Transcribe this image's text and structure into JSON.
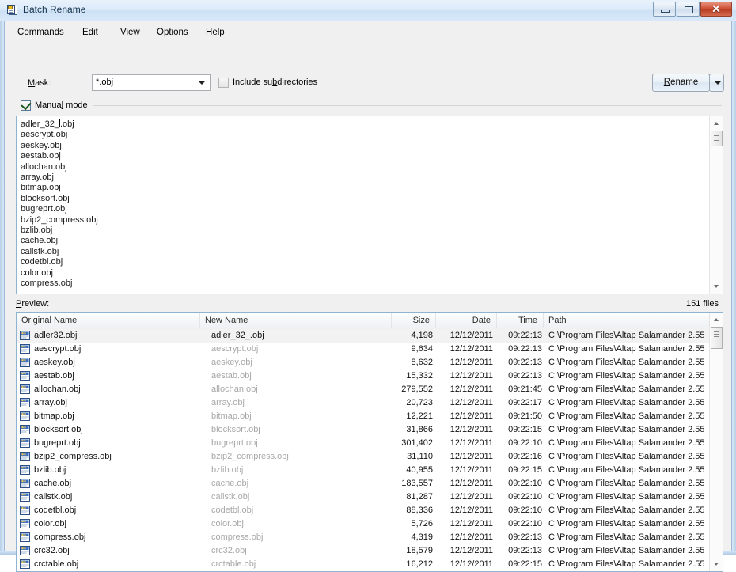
{
  "window": {
    "title": "Batch Rename",
    "icon": "batch-rename-icon",
    "minimize_label": "–",
    "maximize_label": "□",
    "close_label": "✕"
  },
  "menu": [
    {
      "label": "Commands",
      "accel": "C"
    },
    {
      "label": "Edit",
      "accel": "E"
    },
    {
      "label": "View",
      "accel": "V"
    },
    {
      "label": "Options",
      "accel": "O"
    },
    {
      "label": "Help",
      "accel": "H"
    }
  ],
  "options": {
    "mask_label": "Mask:",
    "mask_value": "*.obj",
    "mask_placeholder": "*.*",
    "include_subdirs_label": "Include subdirectories",
    "include_subdirs_checked": false,
    "manual_mode_label": "Manual mode",
    "manual_mode_checked": true,
    "rename_button": "Rename",
    "rename_dropdown_icon": "chevron-down-icon"
  },
  "editor": {
    "lines": [
      "adler_32_.obj",
      "aescrypt.obj",
      "aeskey.obj",
      "aestab.obj",
      "allochan.obj",
      "array.obj",
      "bitmap.obj",
      "blocksort.obj",
      "bugreprt.obj",
      "bzip2_compress.obj",
      "bzlib.obj",
      "cache.obj",
      "callstk.obj",
      "codetbl.obj",
      "color.obj",
      "compress.obj"
    ],
    "caret_line": 0,
    "caret_col": 9
  },
  "preview": {
    "label": "Preview:",
    "files_count": "151 files",
    "columns": [
      {
        "key": "original",
        "label": "Original Name",
        "align": "left"
      },
      {
        "key": "newname",
        "label": "New Name",
        "align": "left"
      },
      {
        "key": "size",
        "label": "Size",
        "align": "right"
      },
      {
        "key": "date",
        "label": "Date",
        "align": "right"
      },
      {
        "key": "time",
        "label": "Time",
        "align": "right"
      },
      {
        "key": "path",
        "label": "Path",
        "align": "left"
      }
    ],
    "rows": [
      {
        "icon": "file-obj-icon",
        "original": "adler32.obj",
        "newname": "adler_32_.obj",
        "size": "4,198",
        "date": "12/12/2011",
        "time": "09:22:13",
        "path": "C:\\Program Files\\Altap Salamander 2.55",
        "selected": true
      },
      {
        "icon": "file-obj-icon",
        "original": "aescrypt.obj",
        "newname": "aescrypt.obj",
        "size": "9,634",
        "date": "12/12/2011",
        "time": "09:22:13",
        "path": "C:\\Program Files\\Altap Salamander 2.55",
        "selected": false
      },
      {
        "icon": "file-obj-icon",
        "original": "aeskey.obj",
        "newname": "aeskey.obj",
        "size": "8,632",
        "date": "12/12/2011",
        "time": "09:22:13",
        "path": "C:\\Program Files\\Altap Salamander 2.55",
        "selected": false
      },
      {
        "icon": "file-obj-icon",
        "original": "aestab.obj",
        "newname": "aestab.obj",
        "size": "15,332",
        "date": "12/12/2011",
        "time": "09:22:13",
        "path": "C:\\Program Files\\Altap Salamander 2.55",
        "selected": false
      },
      {
        "icon": "file-obj-icon",
        "original": "allochan.obj",
        "newname": "allochan.obj",
        "size": "279,552",
        "date": "12/12/2011",
        "time": "09:21:45",
        "path": "C:\\Program Files\\Altap Salamander 2.55",
        "selected": false
      },
      {
        "icon": "file-obj-icon",
        "original": "array.obj",
        "newname": "array.obj",
        "size": "20,723",
        "date": "12/12/2011",
        "time": "09:22:17",
        "path": "C:\\Program Files\\Altap Salamander 2.55",
        "selected": false
      },
      {
        "icon": "file-obj-icon",
        "original": "bitmap.obj",
        "newname": "bitmap.obj",
        "size": "12,221",
        "date": "12/12/2011",
        "time": "09:21:50",
        "path": "C:\\Program Files\\Altap Salamander 2.55",
        "selected": false
      },
      {
        "icon": "file-obj-icon",
        "original": "blocksort.obj",
        "newname": "blocksort.obj",
        "size": "31,866",
        "date": "12/12/2011",
        "time": "09:22:15",
        "path": "C:\\Program Files\\Altap Salamander 2.55",
        "selected": false
      },
      {
        "icon": "file-obj-icon",
        "original": "bugreprt.obj",
        "newname": "bugreprt.obj",
        "size": "301,402",
        "date": "12/12/2011",
        "time": "09:22:10",
        "path": "C:\\Program Files\\Altap Salamander 2.55",
        "selected": false
      },
      {
        "icon": "file-obj-icon",
        "original": "bzip2_compress.obj",
        "newname": "bzip2_compress.obj",
        "size": "31,110",
        "date": "12/12/2011",
        "time": "09:22:16",
        "path": "C:\\Program Files\\Altap Salamander 2.55",
        "selected": false
      },
      {
        "icon": "file-obj-icon",
        "original": "bzlib.obj",
        "newname": "bzlib.obj",
        "size": "40,955",
        "date": "12/12/2011",
        "time": "09:22:15",
        "path": "C:\\Program Files\\Altap Salamander 2.55",
        "selected": false
      },
      {
        "icon": "file-obj-icon",
        "original": "cache.obj",
        "newname": "cache.obj",
        "size": "183,557",
        "date": "12/12/2011",
        "time": "09:22:10",
        "path": "C:\\Program Files\\Altap Salamander 2.55",
        "selected": false
      },
      {
        "icon": "file-obj-icon",
        "original": "callstk.obj",
        "newname": "callstk.obj",
        "size": "81,287",
        "date": "12/12/2011",
        "time": "09:22:10",
        "path": "C:\\Program Files\\Altap Salamander 2.55",
        "selected": false
      },
      {
        "icon": "file-obj-icon",
        "original": "codetbl.obj",
        "newname": "codetbl.obj",
        "size": "88,336",
        "date": "12/12/2011",
        "time": "09:22:10",
        "path": "C:\\Program Files\\Altap Salamander 2.55",
        "selected": false
      },
      {
        "icon": "file-obj-icon",
        "original": "color.obj",
        "newname": "color.obj",
        "size": "5,726",
        "date": "12/12/2011",
        "time": "09:22:10",
        "path": "C:\\Program Files\\Altap Salamander 2.55",
        "selected": false
      },
      {
        "icon": "file-obj-icon",
        "original": "compress.obj",
        "newname": "compress.obj",
        "size": "4,319",
        "date": "12/12/2011",
        "time": "09:22:13",
        "path": "C:\\Program Files\\Altap Salamander 2.55",
        "selected": false
      },
      {
        "icon": "file-obj-icon",
        "original": "crc32.obj",
        "newname": "crc32.obj",
        "size": "18,579",
        "date": "12/12/2011",
        "time": "09:22:13",
        "path": "C:\\Program Files\\Altap Salamander 2.55",
        "selected": false
      },
      {
        "icon": "file-obj-icon",
        "original": "crctable.obj",
        "newname": "crctable.obj",
        "size": "16,212",
        "date": "12/12/2011",
        "time": "09:22:15",
        "path": "C:\\Program Files\\Altap Salamander 2.55",
        "selected": false
      }
    ]
  },
  "colors": {
    "accent": "#8fb3d3",
    "window_bg": "#f0f0f0",
    "close_button": "#b43a20",
    "selected_row": "#f2f2f2",
    "inactive_text": "#a8a8a8"
  }
}
